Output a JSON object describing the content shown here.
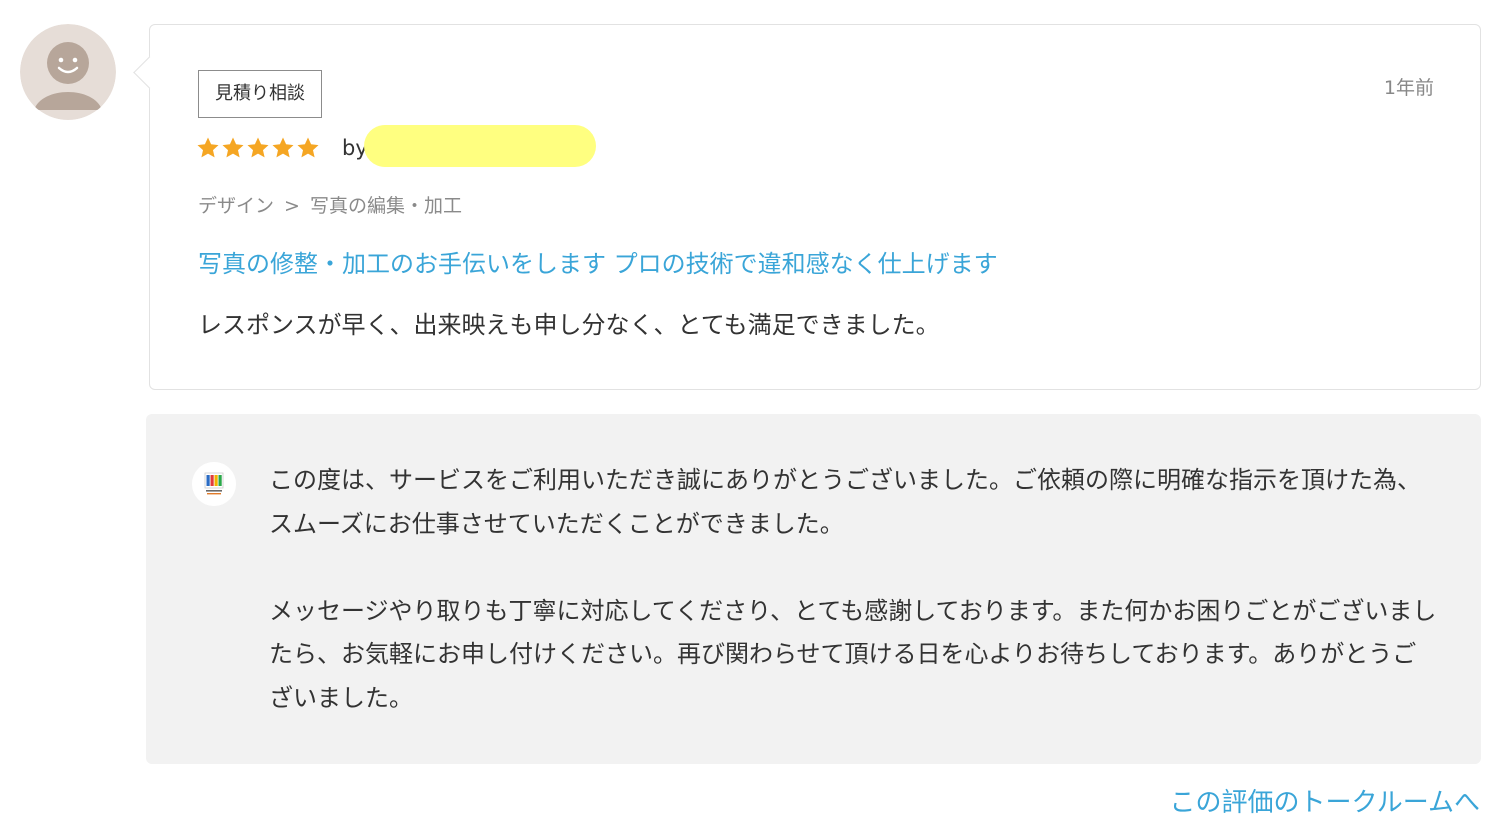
{
  "reviewer": {
    "avatar_icon": "default-user-avatar-icon",
    "redacted_name": ""
  },
  "review": {
    "badge": "見積り相談",
    "timestamp": "1年前",
    "rating": 5,
    "rating_max": 5,
    "star_color": "#f5a623",
    "by_label": "by",
    "breadcrumb": {
      "category": "デザイン",
      "separator": ">",
      "subcategory": "写真の編集・加工"
    },
    "service_title": "写真の修整・加工のお手伝いをします プロの技術で違和感なく仕上げます",
    "body": "レスポンスが早く、出来映えも申し分なく、とても満足できました。"
  },
  "reply": {
    "seller_icon": "seller-logo-icon",
    "paragraphs": [
      "この度は、サービスをご利用いただき誠にありがとうございました。ご依頼の際に明確な指示を頂けた為、スムーズにお仕事させていただくことができました。",
      "メッセージやり取りも丁寧に対応してくださり、とても感謝しております。また何かお困りごとがございましたら、お気軽にお申し付けください。再び関わらせて頂ける日を心よりお待ちしております。ありがとうございました。"
    ]
  },
  "footer": {
    "talkroom_link": "この評価のトークルームへ"
  },
  "colors": {
    "link": "#3aa5d8",
    "redaction": "#ffff80",
    "reply_background": "#f2f2f2"
  }
}
